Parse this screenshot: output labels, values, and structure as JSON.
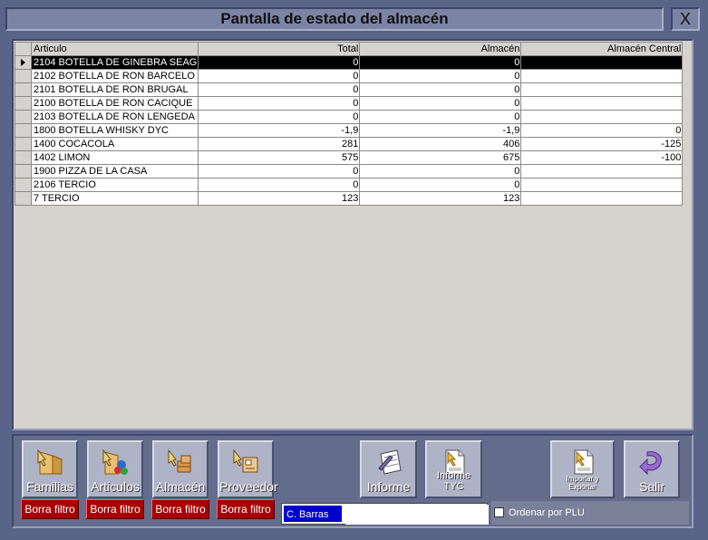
{
  "window": {
    "title": "Pantalla de estado del almacén",
    "close_label": "X"
  },
  "grid": {
    "columns": [
      "Articulo",
      "Total",
      "Almacén",
      "Almacén Central"
    ],
    "rows": [
      {
        "articulo": "2104 BOTELLA DE GINEBRA SEAG",
        "total": "0",
        "almacen": "0",
        "central": ""
      },
      {
        "articulo": "2102 BOTELLA DE RON BARCELO",
        "total": "0",
        "almacen": "0",
        "central": ""
      },
      {
        "articulo": "2101 BOTELLA DE RON BRUGAL",
        "total": "0",
        "almacen": "0",
        "central": ""
      },
      {
        "articulo": "2100 BOTELLA DE RON CACIQUE",
        "total": "0",
        "almacen": "0",
        "central": ""
      },
      {
        "articulo": "2103 BOTELLA DE RON LENGEDA",
        "total": "0",
        "almacen": "0",
        "central": ""
      },
      {
        "articulo": "1800 BOTELLA WHISKY DYC",
        "total": "-1,9",
        "almacen": "-1,9",
        "central": "0"
      },
      {
        "articulo": "1400 COCACOLA",
        "total": "281",
        "almacen": "406",
        "central": "-125"
      },
      {
        "articulo": "1402 LIMON",
        "total": "575",
        "almacen": "675",
        "central": "-100"
      },
      {
        "articulo": "1900 PIZZA DE LA CASA",
        "total": "0",
        "almacen": "0",
        "central": ""
      },
      {
        "articulo": "2106 TERCIO",
        "total": "0",
        "almacen": "0",
        "central": ""
      },
      {
        "articulo": "7 TERCIO",
        "total": "123",
        "almacen": "123",
        "central": ""
      }
    ],
    "selected_row": 0
  },
  "buttons": {
    "familias": "Familias",
    "articulos": "Articulos",
    "almacen": "Almacén",
    "proveedor": "Proveedor",
    "informe": "Informe",
    "informe_tyc": "Informe TYC",
    "importar": "Importar y Exportar",
    "salir": "Salir",
    "borra_filtro": "Borra filtro"
  },
  "search": {
    "label": "C. Barras",
    "value": ""
  },
  "checkbox": {
    "label": "Ordenar por PLU",
    "checked": false
  },
  "colors": {
    "selected_row_bg": "#000000",
    "filter_button": "#a80000",
    "barcode_label_bg": "#0000cc"
  }
}
